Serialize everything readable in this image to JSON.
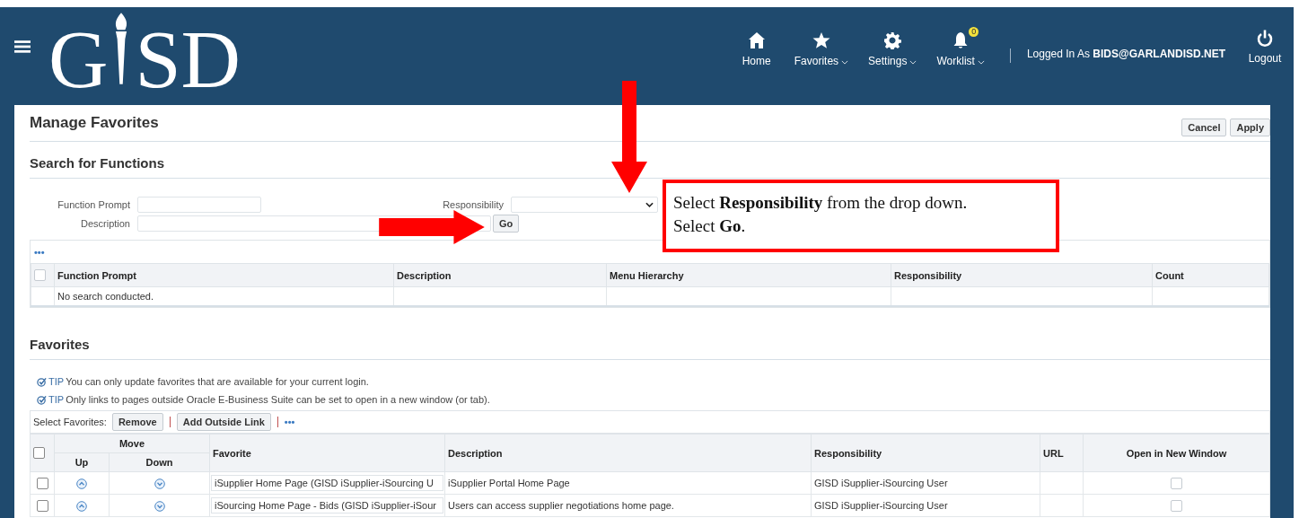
{
  "header": {
    "logo": {
      "left": "G",
      "right": "SD"
    },
    "nav": [
      {
        "label": "Home",
        "dropdown": false
      },
      {
        "label": "Favorites",
        "dropdown": true
      },
      {
        "label": "Settings",
        "dropdown": true
      },
      {
        "label": "Worklist",
        "dropdown": true,
        "badge": "0"
      }
    ],
    "user": {
      "prefix": "Logged In As",
      "name": "BIDS@GARLANDISD.NET"
    },
    "logout": "Logout"
  },
  "page": {
    "title": "Manage Favorites",
    "actions": [
      "Cancel",
      "Apply"
    ]
  },
  "search": {
    "title": "Search for Functions",
    "function_prompt": {
      "label": "Function Prompt"
    },
    "description": {
      "label": "Description"
    },
    "responsibility": {
      "label": "Responsibility"
    },
    "go": "Go",
    "more": "•••",
    "select_all": false,
    "columns": [
      "Function Prompt",
      "Description",
      "Menu Hierarchy",
      "Responsibility",
      "Count"
    ],
    "empty": "No search conducted."
  },
  "callout": {
    "lines": [
      "Select **Responsibility** from the drop down.",
      "Select **Go**."
    ]
  },
  "favorites": {
    "title": "Favorites",
    "tips": [
      {
        "label": "TIP",
        "text": "You can only update favorites that are available for your current login."
      },
      {
        "label": "TIP",
        "text": "Only links to pages outside Oracle E-Business Suite can be set to open in a new window (or tab)."
      }
    ],
    "toolbar": {
      "label": "Select Favorites:",
      "buttons": [
        "Remove",
        "Add Outside Link"
      ],
      "more": "•••"
    },
    "select_all": false,
    "columns": {
      "move": "Move",
      "up": "Up",
      "down": "Down",
      "favorite": "Favorite",
      "description": "Description",
      "responsibility": "Responsibility",
      "url": "URL",
      "new_window": "Open in New Window"
    },
    "rows": [
      {
        "selected": false,
        "favorite": "iSupplier Home Page (GISD iSupplier-iSourcing U",
        "description": "iSupplier Portal Home Page",
        "responsibility": "GISD iSupplier-iSourcing User",
        "new_window": false
      },
      {
        "selected": false,
        "favorite": "iSourcing Home Page - Bids (GISD iSupplier-iSour",
        "description": "Users can access supplier negotiations home page.",
        "responsibility": "GISD iSupplier-iSourcing User",
        "new_window": false
      }
    ]
  }
}
